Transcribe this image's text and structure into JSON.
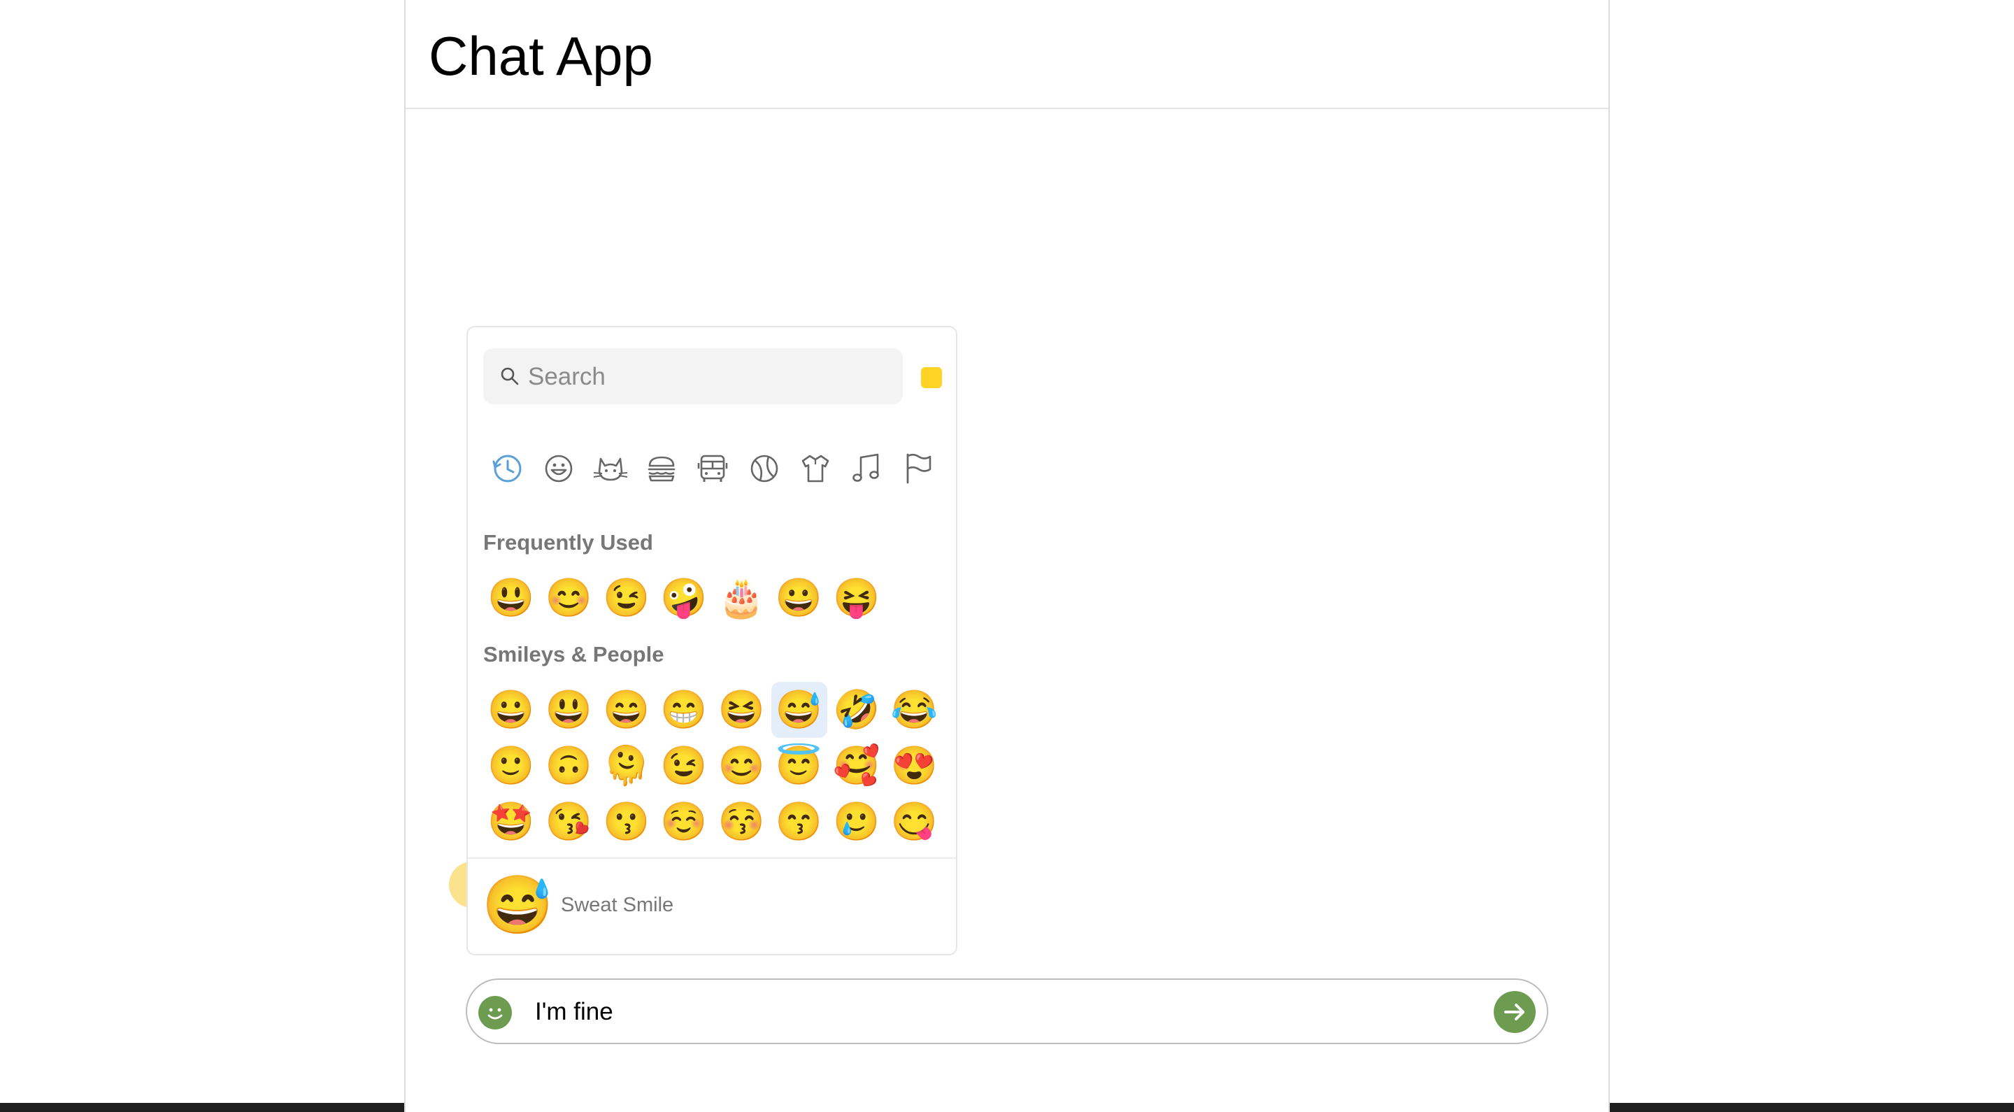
{
  "app": {
    "title": "Chat App"
  },
  "emoji_picker": {
    "search": {
      "placeholder": "Search",
      "value": ""
    },
    "skin_tone_color": "#ffd226",
    "categories": [
      {
        "name": "frequently-used",
        "icon": "clock-icon",
        "active": true
      },
      {
        "name": "smileys-people",
        "icon": "smiley-icon",
        "active": false
      },
      {
        "name": "animals-nature",
        "icon": "cat-icon",
        "active": false
      },
      {
        "name": "food-drink",
        "icon": "burger-icon",
        "active": false
      },
      {
        "name": "travel-places",
        "icon": "bus-icon",
        "active": false
      },
      {
        "name": "activities",
        "icon": "ball-icon",
        "active": false
      },
      {
        "name": "objects",
        "icon": "shirt-icon",
        "active": false
      },
      {
        "name": "symbols",
        "icon": "music-note-icon",
        "active": false
      },
      {
        "name": "flags",
        "icon": "flag-icon",
        "active": false
      }
    ],
    "sections": [
      {
        "title": "Frequently Used",
        "emojis": [
          "😃",
          "😊",
          "😉",
          "🤪",
          "🎂",
          "😀",
          "😝"
        ]
      },
      {
        "title": "Smileys & People",
        "emojis": [
          "😀",
          "😃",
          "😄",
          "😁",
          "😆",
          "😅",
          "🤣",
          "😂",
          "🙂",
          "🙃",
          "🫠",
          "😉",
          "😊",
          "😇",
          "🥰",
          "😍",
          "🤩",
          "😘",
          "😗",
          "☺️",
          "😚",
          "😙",
          "🥲",
          "😋",
          "😛",
          "😜",
          "🤪",
          "😝",
          "🤑",
          "🤗",
          "🤭",
          "🫢"
        ]
      }
    ],
    "preview": {
      "emoji": "😅",
      "name": "Sweat Smile"
    }
  },
  "composer": {
    "value": "I'm fine",
    "accent_color": "#6d9b4f"
  }
}
